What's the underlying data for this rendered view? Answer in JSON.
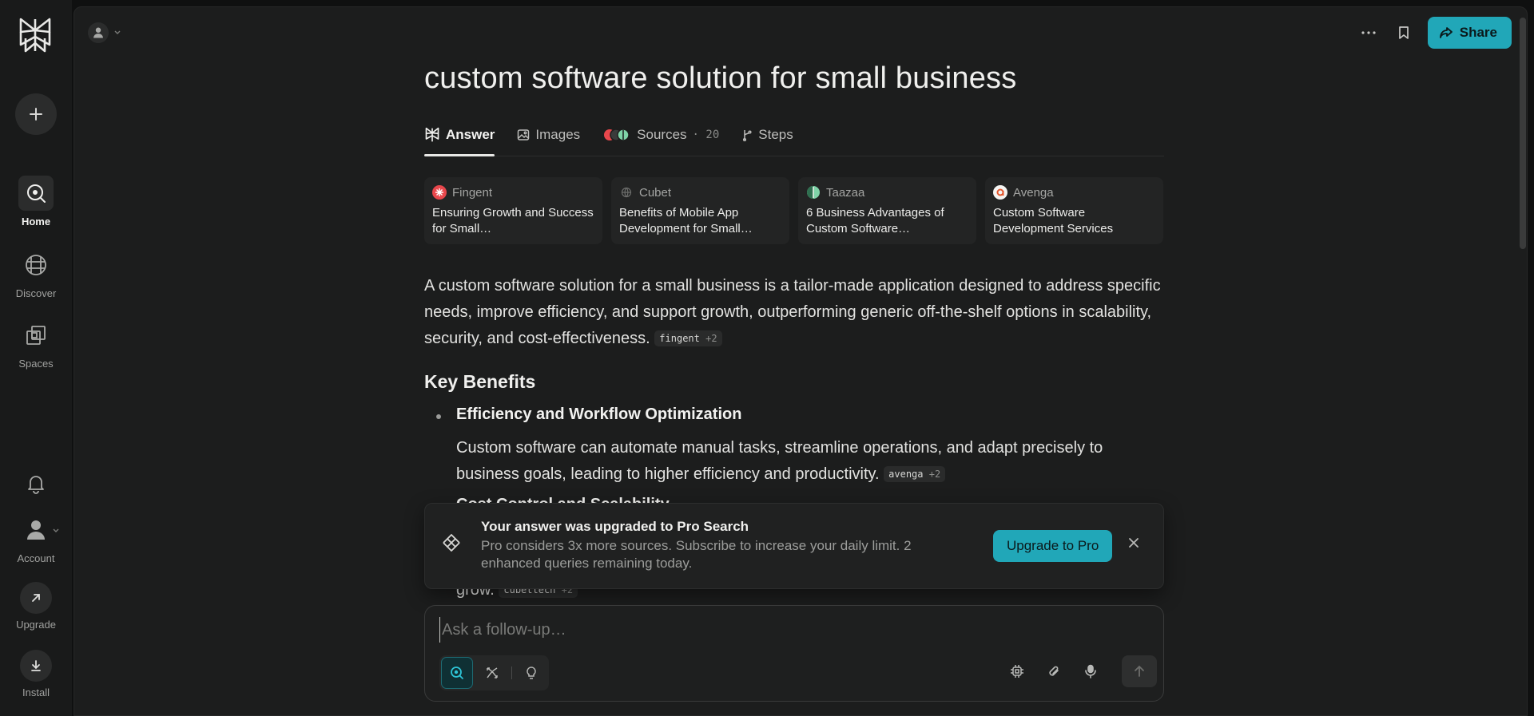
{
  "sidebar": {
    "items": [
      {
        "label": "Home"
      },
      {
        "label": "Discover"
      },
      {
        "label": "Spaces"
      }
    ],
    "account_label": "Account",
    "upgrade_label": "Upgrade",
    "install_label": "Install"
  },
  "header": {
    "share_label": "Share"
  },
  "thread": {
    "title": "custom software solution for small business",
    "tabs": [
      {
        "label": "Answer"
      },
      {
        "label": "Images"
      },
      {
        "label": "Sources",
        "count": "· 20"
      },
      {
        "label": "Steps"
      }
    ],
    "sources": [
      {
        "site": "Fingent",
        "title": "Ensuring Growth and Success for Small…",
        "color": "#e8474c"
      },
      {
        "site": "Cubet",
        "title": "Benefits of Mobile App Development for Small…",
        "color": "#6d6e6c"
      },
      {
        "site": "Taazaa",
        "title": "6 Business Advantages of Custom Software…",
        "color": "#7fd3a8"
      },
      {
        "site": "Avenga",
        "title": "Custom Software Development Services",
        "color": "#e4572e"
      }
    ],
    "intro": "A custom software solution for a small business is a tailor-made application designed to address specific needs, improve efficiency, and support growth, outperforming generic off-the-shelf options in scalability, security, and cost-effectiveness.",
    "intro_cite": {
      "source": "fingent",
      "more": "+2"
    },
    "section_heading": "Key Benefits",
    "bullets": [
      {
        "title": "Efficiency and Workflow Optimization",
        "text": "Custom software can automate manual tasks, streamline operations, and adapt precisely to business goals, leading to higher efficiency and productivity.",
        "cite": {
          "source": "avenga",
          "more": "+2"
        }
      }
    ],
    "partial_bullet_title": "Cost Control and Scalability",
    "partial_tail": "grow.",
    "partial_cite": {
      "source": "cubettech",
      "more": "+2"
    }
  },
  "toast": {
    "title": "Your answer was upgraded to Pro Search",
    "text": "Pro considers 3x more sources. Subscribe to increase your daily limit. 2 enhanced queries remaining today.",
    "button_label": "Upgrade to Pro"
  },
  "composer": {
    "placeholder": "Ask a follow-up…",
    "value": ""
  },
  "colors": {
    "accent": "#21a7b8",
    "background": "#1c1d1d",
    "sidebar": "#191a1a"
  }
}
